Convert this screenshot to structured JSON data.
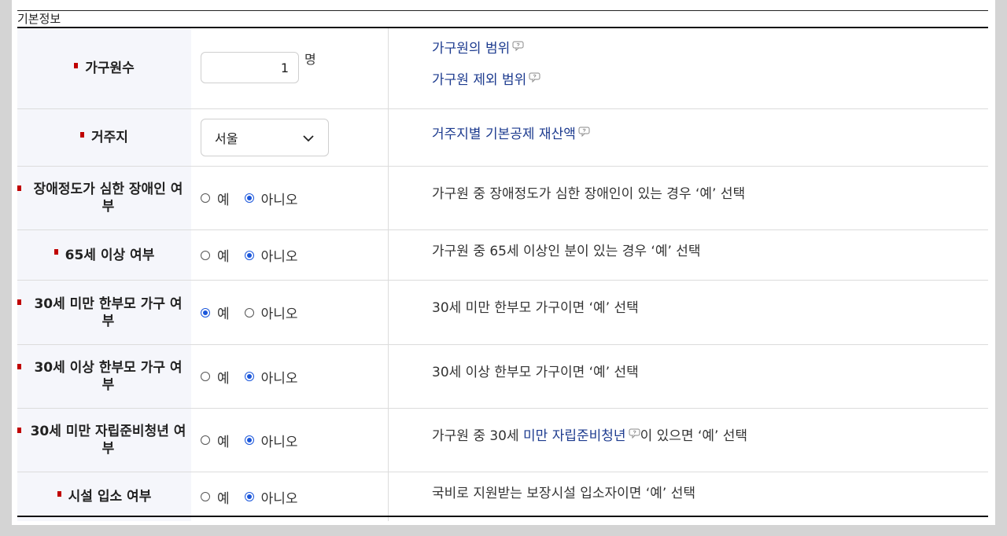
{
  "section_title": "기본정보",
  "rows": [
    {
      "label": "가구원수",
      "input_value": "1",
      "unit": "명",
      "links": [
        "가구원의 범위",
        "가구원 제외 범위"
      ]
    },
    {
      "label": "거주지",
      "select_value": "서울",
      "links": [
        "거주지별 기본공제 재산액"
      ]
    },
    {
      "label": "장애정도가 심한 장애인 여부",
      "desc": "가구원 중 장애정도가 심한 장애인이 있는 경우 ‘예’ 선택",
      "selected": "아니오"
    },
    {
      "label": "65세 이상 여부",
      "desc": "가구원 중 65세 이상인 분이 있는 경우 ‘예’ 선택",
      "selected": "아니오"
    },
    {
      "label": "30세 미만 한부모 가구 여부",
      "desc": "30세 미만 한부모 가구이면 ‘예’ 선택",
      "selected": "예"
    },
    {
      "label": "30세 이상 한부모 가구 여부",
      "desc": "30세 이상 한부모 가구이면 ‘예’ 선택",
      "selected": "아니오"
    },
    {
      "label": "30세 미만 자립준비청년 여부",
      "desc_prefix": "가구원 중 30세 ",
      "desc_link": "미만 자립준비청년",
      "desc_suffix": "이 있으면 ‘예’ 선택",
      "selected": "아니오"
    },
    {
      "label": "시설 입소 여부",
      "desc": "국비로 지원받는 보장시설 입소자이면 ‘예’ 선택",
      "selected": "아니오"
    }
  ],
  "radio_options": {
    "yes": "예",
    "no": "아니오"
  },
  "colors": {
    "required_mark": "#c00000",
    "link": "#1d3b8f",
    "radio_checked": "#1a56db",
    "label_bg": "#f5f6fb"
  },
  "icons": {
    "help": "speech-bubble-help-icon",
    "dropdown": "chevron-down-icon"
  }
}
